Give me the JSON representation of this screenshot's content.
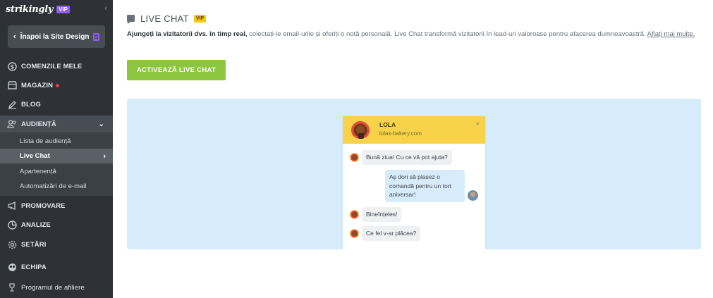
{
  "sidebar": {
    "logo": "strikingly",
    "logo_badge": "VIP",
    "collapse_icon": "‹",
    "back_button": "Înapoi la Site Design",
    "items": [
      {
        "label": "COMENZILE MELE",
        "icon": "dollar-circle-icon"
      },
      {
        "label": "MAGAZIN",
        "icon": "store-icon",
        "badge_color": "#e53e3e"
      },
      {
        "label": "BLOG",
        "icon": "pen-icon"
      },
      {
        "label": "AUDIENȚĂ",
        "icon": "users-icon"
      },
      {
        "label": "PROMOVARE",
        "icon": "megaphone-icon"
      },
      {
        "label": "ANALIZE",
        "icon": "pie-chart-icon"
      },
      {
        "label": "SETĂRI",
        "icon": "gear-icon"
      },
      {
        "label": "ECHIPA",
        "icon": "team-icon"
      },
      {
        "label": "Programul de afiliere",
        "icon": "trophy-icon"
      }
    ],
    "sub_items": [
      {
        "label": "Lista de audiență"
      },
      {
        "label": "Live Chat",
        "active": true
      },
      {
        "label": "Apartenență"
      },
      {
        "label": "Automatizări de e-mail"
      }
    ]
  },
  "main": {
    "title": "LIVE CHAT",
    "vip": "VIP",
    "desc_bold": "Ajungeți la vizitatorii dvs. în timp real,",
    "desc_rest": " colectați-le email-urile și oferiți o notă personală. Live Chat transformă vizitatorii în lead-uri valoroase pentru afacerea dumneavoastră. ",
    "desc_link": "Aflați mai multe.",
    "activate_button": "ACTIVEAZĂ LIVE CHAT"
  },
  "widget": {
    "agent_name": "LOLA",
    "agent_site": "lolas-bakery.com",
    "close": "×",
    "messages": [
      {
        "from": "agent",
        "text": "Bună ziua! Cu ce vă pot ajuta?"
      },
      {
        "from": "user",
        "text": "Aș dori să plasez o comandă pentru un tort aniversar!"
      },
      {
        "from": "agent",
        "text": "Bineînțeles!"
      },
      {
        "from": "agent",
        "text": "Ce fel v-ar plăcea?"
      }
    ]
  },
  "colors": {
    "sidebar_bg": "#2e3236",
    "accent_green": "#8cc63f",
    "vip_yellow": "#f5c518",
    "preview_bg": "#d6ecfb",
    "widget_header": "#f8d34a"
  }
}
